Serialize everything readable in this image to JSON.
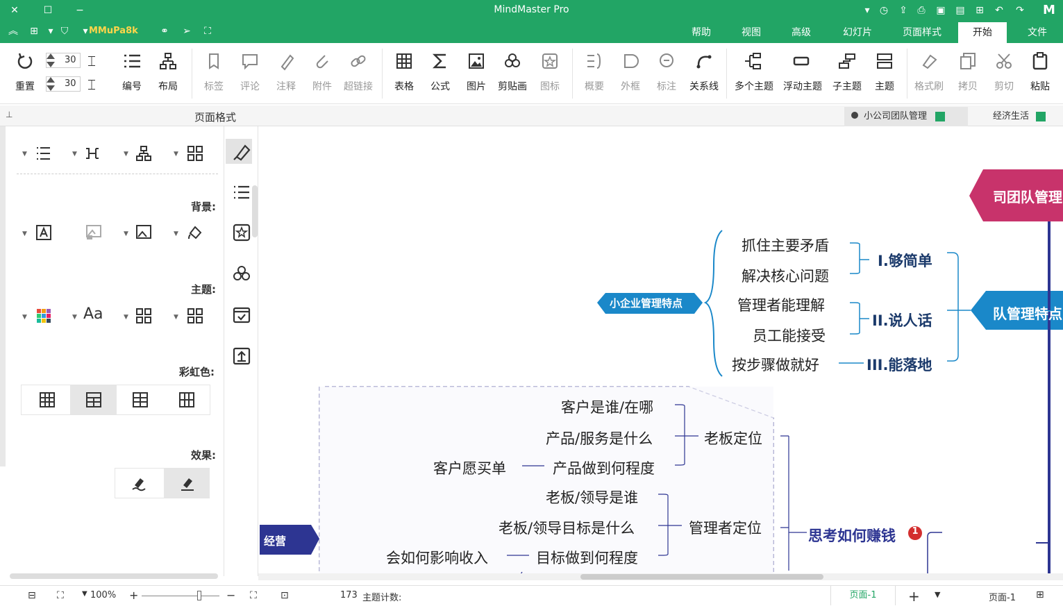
{
  "window": {
    "title": "MindMaster Pro"
  },
  "menu": {
    "tabs": [
      "文件",
      "开始",
      "页面样式",
      "幻灯片",
      "高级",
      "视图",
      "帮助"
    ],
    "active": "开始",
    "user": "MMuPa8k"
  },
  "ribbon": {
    "groups": [
      {
        "label": "粘贴"
      },
      {
        "label": "剪切"
      },
      {
        "label": "拷贝"
      },
      {
        "label": "格式刷"
      },
      {
        "label": "主题"
      },
      {
        "label": "子主题"
      },
      {
        "label": "浮动主题"
      },
      {
        "label": "多个主题"
      },
      {
        "label": "关系线"
      },
      {
        "label": "标注"
      },
      {
        "label": "外框"
      },
      {
        "label": "概要"
      },
      {
        "label": "图标"
      },
      {
        "label": "剪贴画"
      },
      {
        "label": "图片"
      },
      {
        "label": "公式"
      },
      {
        "label": "表格"
      },
      {
        "label": "超链接"
      },
      {
        "label": "附件"
      },
      {
        "label": "注释"
      },
      {
        "label": "评论"
      },
      {
        "label": "标签"
      },
      {
        "label": "布局"
      },
      {
        "label": "编号"
      },
      {
        "label": "重置"
      }
    ],
    "spacing1": "30",
    "spacing2": "30"
  },
  "doc_tabs": [
    {
      "label": "经济生活"
    },
    {
      "label": "小公司团队管理",
      "active": true
    }
  ],
  "panel": {
    "title": "页面格式",
    "background_label": "背景:",
    "theme_label": "主题:",
    "rainbow_label": "彩虹色:",
    "effect_label": "效果:"
  },
  "mindmap": {
    "top_node": "司团队管理",
    "branch1": "队管理特点",
    "callout1": "小企业管理特点",
    "level1": [
      {
        "label": "I.够简单",
        "children": [
          "抓住主要矛盾",
          "解决核心问题"
        ]
      },
      {
        "label": "II.说人话",
        "children": [
          "管理者能理解",
          "员工能接受"
        ]
      },
      {
        "label": "III.能落地",
        "children": [
          "按步骤做就好"
        ]
      }
    ],
    "branch2": "思考如何赚钱",
    "branch2_badge": "1",
    "callout2": "经营",
    "sub_a": {
      "label": "老板定位",
      "children": [
        "客户是谁/在哪",
        "产品/服务是什么",
        "产品做到何程度"
      ],
      "extra": "客户愿买单"
    },
    "sub_b": {
      "label": "管理者定位",
      "children": [
        "老板/领导是谁",
        "老板/领导目标是什么",
        "目标做到何程度"
      ],
      "extra": "会如何影响收入"
    }
  },
  "status": {
    "topic_count_label": "主题计数:",
    "topic_count": "173",
    "zoom": "100%",
    "page_tab": "页面-1",
    "page_tab2": "页面-1"
  },
  "colors": {
    "brand": "#22a565",
    "node_pink": "#c8336b",
    "node_blue": "#1a88c9",
    "node_dark": "#2d3592",
    "text_navy": "#1b3a6b"
  }
}
